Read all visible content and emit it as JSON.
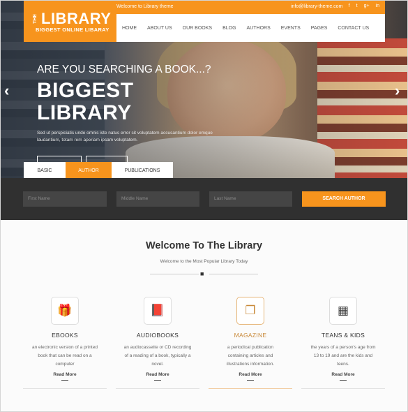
{
  "brand": {
    "the": "THE",
    "name": "LIBRARY",
    "tagline": "BIGGEST ONLINE LIBARAY",
    "color": "#f7941d"
  },
  "topbar": {
    "welcome": "Welcome to Library theme",
    "email": "info@library-theme.com",
    "social": [
      "f",
      "t",
      "g+",
      "in"
    ]
  },
  "nav": [
    "HOME",
    "ABOUT US",
    "OUR BOOKS",
    "BLOG",
    "AUTHORS",
    "EVENTS",
    "PAGES",
    "CONTACT US"
  ],
  "hero": {
    "question": "ARE YOU SEARCHING A BOOK...?",
    "headline_1": "BIGGEST",
    "headline_2": "LIBRARY",
    "description": "Sed ut perspiciatis unde omnis iste natus error sit voluptatem accusantium dolor emque laudantium, totam rem aperiam ipsam voluptatem.",
    "prev": "‹",
    "next": "›"
  },
  "tabs": [
    {
      "label": "BASIC",
      "active": false
    },
    {
      "label": "AUTHOR",
      "active": true
    },
    {
      "label": "PUBLICATIONS",
      "active": false
    }
  ],
  "search": {
    "first": "First Name",
    "middle": "Middle Name",
    "last": "Last Name",
    "button": "SEARCH AUTHOR"
  },
  "welcome": {
    "title": "Welcome To The Library",
    "subtitle": "Welcome to the Most Popular Library Today"
  },
  "categories": [
    {
      "icon": "gift-icon",
      "glyph": "🎁",
      "title": "EBOOKS",
      "desc_1": "an electronic version of a printed",
      "desc_2": "book that can be read on a",
      "desc_3": "computer",
      "more": "Read More",
      "highlight": false
    },
    {
      "icon": "book-icon",
      "glyph": "📕",
      "title": "AUDIOBOOKS",
      "desc_1": "an audiocassette or CD recording",
      "desc_2": "of a reading of a book, typically a",
      "desc_3": "novel.",
      "more": "Read More",
      "highlight": false
    },
    {
      "icon": "copy-icon",
      "glyph": "❐",
      "title": "MAGAZINE",
      "desc_1": "a periodical publication",
      "desc_2": "containing articles and",
      "desc_3": "illustrations information.",
      "more": "Read More",
      "highlight": true
    },
    {
      "icon": "calculator-icon",
      "glyph": "▦",
      "title": "TEANS & KIDS",
      "desc_1": "the years of a person's age from",
      "desc_2": "13 to 19 and are the kids and",
      "desc_3": "teens.",
      "more": "Read More",
      "highlight": false
    }
  ]
}
